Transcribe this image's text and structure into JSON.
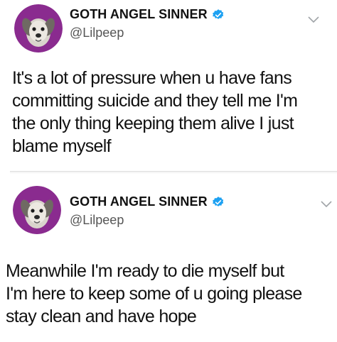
{
  "tweets": [
    {
      "display_name": "GOTH ANGEL SINNER",
      "handle": "@Lilpeep",
      "verified": true,
      "avatar_icon": "dog-avatar-icon",
      "text_lines": [
        "It's a lot of pressure when u have fans",
        "committing suicide and they tell me I'm",
        "the only thing keeping them alive I just",
        "blame myself"
      ]
    },
    {
      "display_name": "GOTH ANGEL SINNER",
      "handle": "@Lilpeep",
      "verified": true,
      "avatar_icon": "dog-avatar-icon",
      "text_lines": [
        "Meanwhile I'm ready to die myself but",
        "I'm here to keep some of u going please",
        "stay clean and have hope"
      ]
    }
  ],
  "colors": {
    "verified_badge": "#1da1f2",
    "avatar_background": "#8a2b8f",
    "text": "#111111",
    "handle": "#555555"
  }
}
